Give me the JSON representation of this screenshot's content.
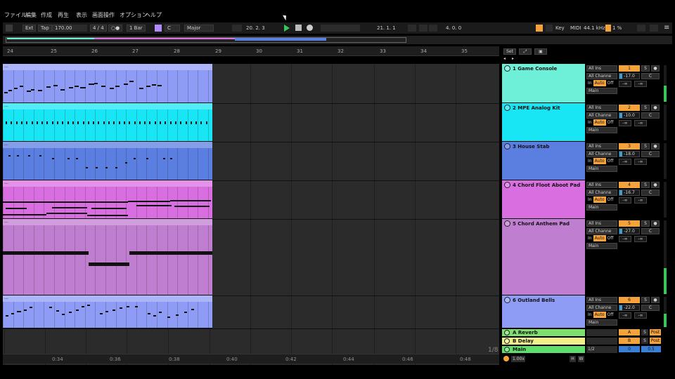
{
  "menu": [
    "ファイル",
    "編集",
    "作成",
    "再生",
    "表示",
    "画面操作",
    "オプション",
    "ヘルプ"
  ],
  "control_bar": {
    "ext": "Ext",
    "tap": "Tap",
    "tempo": "170.00",
    "time_sig": "4 / 4",
    "metronome": "○●",
    "quantize": "1 Bar",
    "key": "C",
    "scale": "Major",
    "position": "20.   2.   3",
    "loop_start": "21.   1.   1",
    "loop_length": "4.   0.   0",
    "key_label": "Key",
    "midi_label": "MIDI",
    "sample_rate": "44.1 kHz",
    "cpu": "1 %"
  },
  "ruler": {
    "bars": [
      "24",
      "25",
      "26",
      "27",
      "28",
      "29",
      "30",
      "31",
      "32",
      "33",
      "34",
      "35"
    ],
    "set_label": "Set"
  },
  "time_ruler": [
    "0:34",
    "0:36",
    "0:38",
    "0:40",
    "0:42",
    "0:44",
    "0:46",
    "0:48"
  ],
  "tracks": [
    {
      "name": "1 Game Console",
      "num": "1",
      "solo": "S",
      "input": "All Ins",
      "channel": "All Channe",
      "monitor": [
        "In",
        "Auto",
        "Off"
      ],
      "output": "Main",
      "volume": "-17.0",
      "pan": "C",
      "send1": "-∞",
      "send2": "-∞",
      "color": "#6ef0d8",
      "clip_color": "#8f9cf5",
      "meter": 0.45
    },
    {
      "name": "2 MPE Analog Kit",
      "num": "2",
      "solo": "S",
      "input": "All Ins",
      "channel": "All Channe",
      "monitor": [
        "In",
        "Auto",
        "Off"
      ],
      "output": "Main",
      "volume": "-10.0",
      "pan": "C",
      "send1": "-∞",
      "send2": "-∞",
      "color": "#18e6f5",
      "clip_color": "#18e6f5",
      "meter": 0.0
    },
    {
      "name": "3 House Stab",
      "num": "3",
      "solo": "S",
      "input": "All Ins",
      "channel": "All Channe",
      "monitor": [
        "In",
        "Auto",
        "Off"
      ],
      "output": "Main",
      "volume": "-18.0",
      "pan": "C",
      "send1": "-∞",
      "send2": "-∞",
      "color": "#5b7fe0",
      "clip_color": "#5b7fe0",
      "meter": 0.0
    },
    {
      "name": "4 Chord Floot Aboot Pad",
      "num": "4",
      "solo": "S",
      "input": "All Ins",
      "channel": "All Channe",
      "monitor": [
        "In",
        "Auto",
        "Off"
      ],
      "output": "Main",
      "volume": "-16.7",
      "pan": "C",
      "send1": "-∞",
      "send2": "-∞",
      "color": "#d86ee0",
      "clip_color": "#d86ee0",
      "meter": 0.0
    },
    {
      "name": "5 Chord Anthem Pad",
      "num": "5",
      "solo": "S",
      "input": "All Ins",
      "channel": "All Channe",
      "monitor": [
        "In",
        "Auto",
        "Off"
      ],
      "output": "Main",
      "volume": "-27.0",
      "pan": "C",
      "send1": "-∞",
      "send2": "-∞",
      "color": "#c07ed0",
      "clip_color": "#c07ed0",
      "meter": 0.35
    },
    {
      "name": "6 Outland Bells",
      "num": "6",
      "solo": "S",
      "input": "All Ins",
      "channel": "All Channe",
      "monitor": [
        "In",
        "Auto",
        "Off"
      ],
      "output": "Main",
      "volume": "-22.0",
      "pan": "C",
      "send1": "-∞",
      "send2": "-∞",
      "color": "#8f9cf5",
      "clip_color": "#8f9cf5",
      "meter": 0.45
    }
  ],
  "returns": [
    {
      "name": "A Reverb",
      "letter": "A",
      "solo": "S",
      "post": "Post",
      "color": "#7de06e"
    },
    {
      "name": "B Delay",
      "letter": "B",
      "solo": "S",
      "post": "Post",
      "color": "#f0f08a"
    },
    {
      "name": "Main",
      "letter": "0",
      "solo": "",
      "post": "0.5",
      "color": "#5fdf6a",
      "quant": "1/2"
    }
  ],
  "page_indicator": "1/8",
  "zoom": "1.00x",
  "hw_labels": [
    "H",
    "W"
  ]
}
